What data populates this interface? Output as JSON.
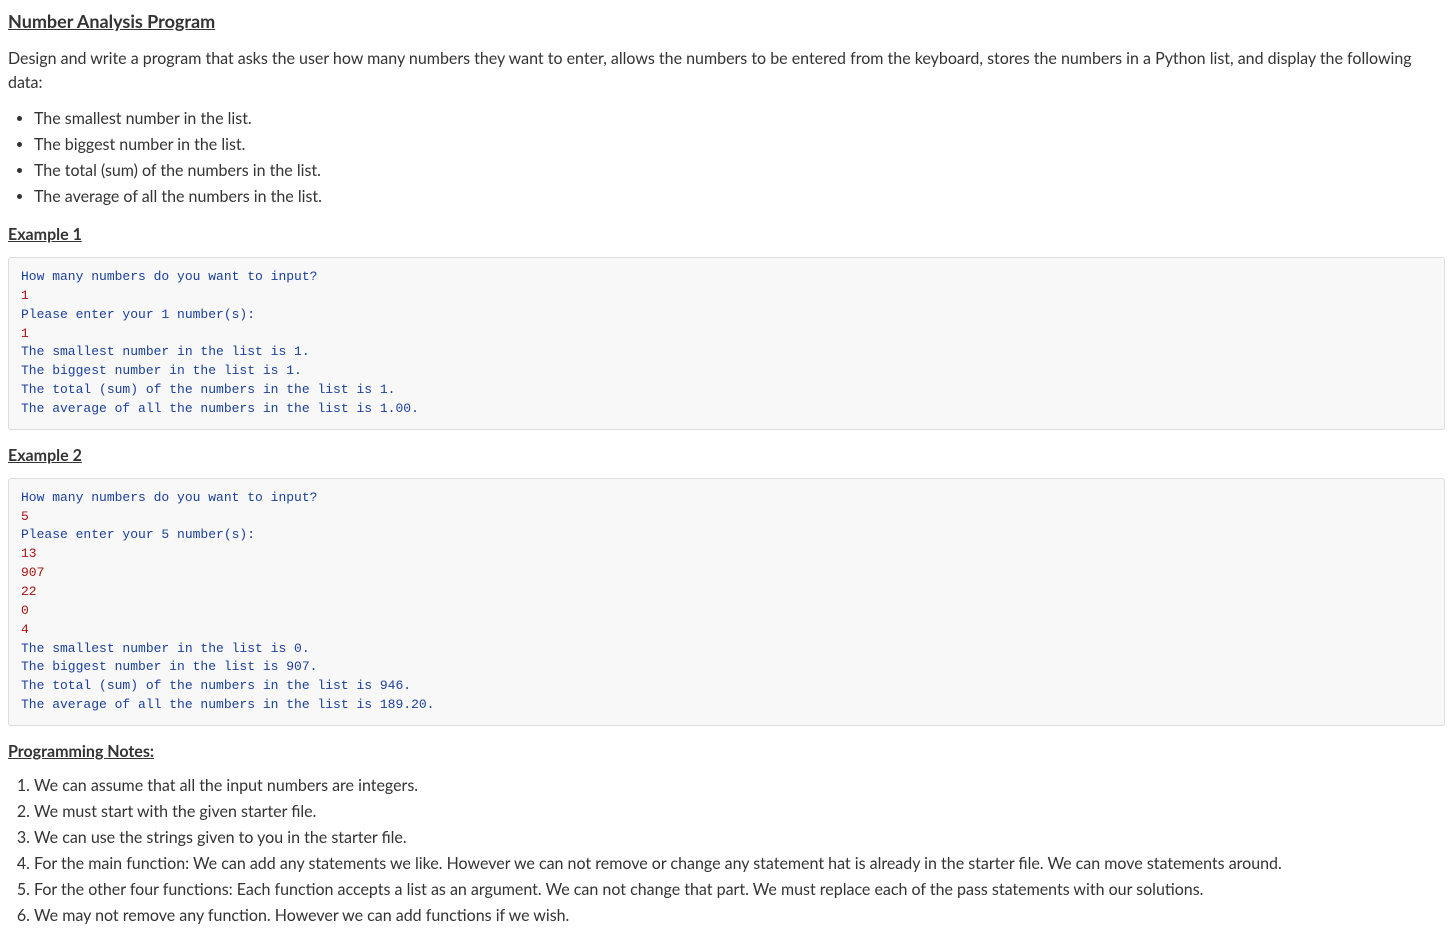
{
  "title": "Number Analysis Program",
  "description": "Design and write a program that asks the user how many numbers they want to enter, allows the numbers to be entered from the keyboard, stores the numbers in a Python list, and display the following data:",
  "bullets": [
    "The smallest number in the list.",
    "The biggest number in the list.",
    "The total (sum) of the numbers in the list.",
    "The average of all the numbers in the list."
  ],
  "example1_heading": "Example 1",
  "example1_lines": [
    {
      "cls": "out",
      "text": "How many numbers do you want to input?"
    },
    {
      "cls": "inp",
      "text": "1"
    },
    {
      "cls": "out",
      "text": "Please enter your 1 number(s):"
    },
    {
      "cls": "inp",
      "text": "1"
    },
    {
      "cls": "out",
      "text": "The smallest number in the list is 1."
    },
    {
      "cls": "out",
      "text": "The biggest number in the list is 1."
    },
    {
      "cls": "out",
      "text": "The total (sum) of the numbers in the list is 1."
    },
    {
      "cls": "out",
      "text": "The average of all the numbers in the list is 1.00."
    }
  ],
  "example2_heading": "Example 2",
  "example2_lines": [
    {
      "cls": "out",
      "text": "How many numbers do you want to input?"
    },
    {
      "cls": "inp",
      "text": "5"
    },
    {
      "cls": "out",
      "text": "Please enter your 5 number(s):"
    },
    {
      "cls": "inp",
      "text": "13"
    },
    {
      "cls": "inp",
      "text": "907"
    },
    {
      "cls": "inp",
      "text": "22"
    },
    {
      "cls": "inp",
      "text": "0"
    },
    {
      "cls": "inp",
      "text": "4"
    },
    {
      "cls": "out",
      "text": "The smallest number in the list is 0."
    },
    {
      "cls": "out",
      "text": "The biggest number in the list is 907."
    },
    {
      "cls": "out",
      "text": "The total (sum) of the numbers in the list is 946."
    },
    {
      "cls": "out",
      "text": "The average of all the numbers in the list is 189.20."
    }
  ],
  "notes_heading": "Programming Notes:",
  "notes": [
    "We can assume that all the input numbers are integers.",
    "We must start with the given starter file.",
    "We can use the strings given to you in the starter file.",
    "For the main function: We can add any statements we like. However we can not remove or change any statement hat is already in the starter file. We can move statements around.",
    "For the other four functions: Each function accepts a list as an argument. We can not change that part. We must replace each of the pass statements with our solutions.",
    "We may not remove any function. However we can add functions if we wish."
  ]
}
